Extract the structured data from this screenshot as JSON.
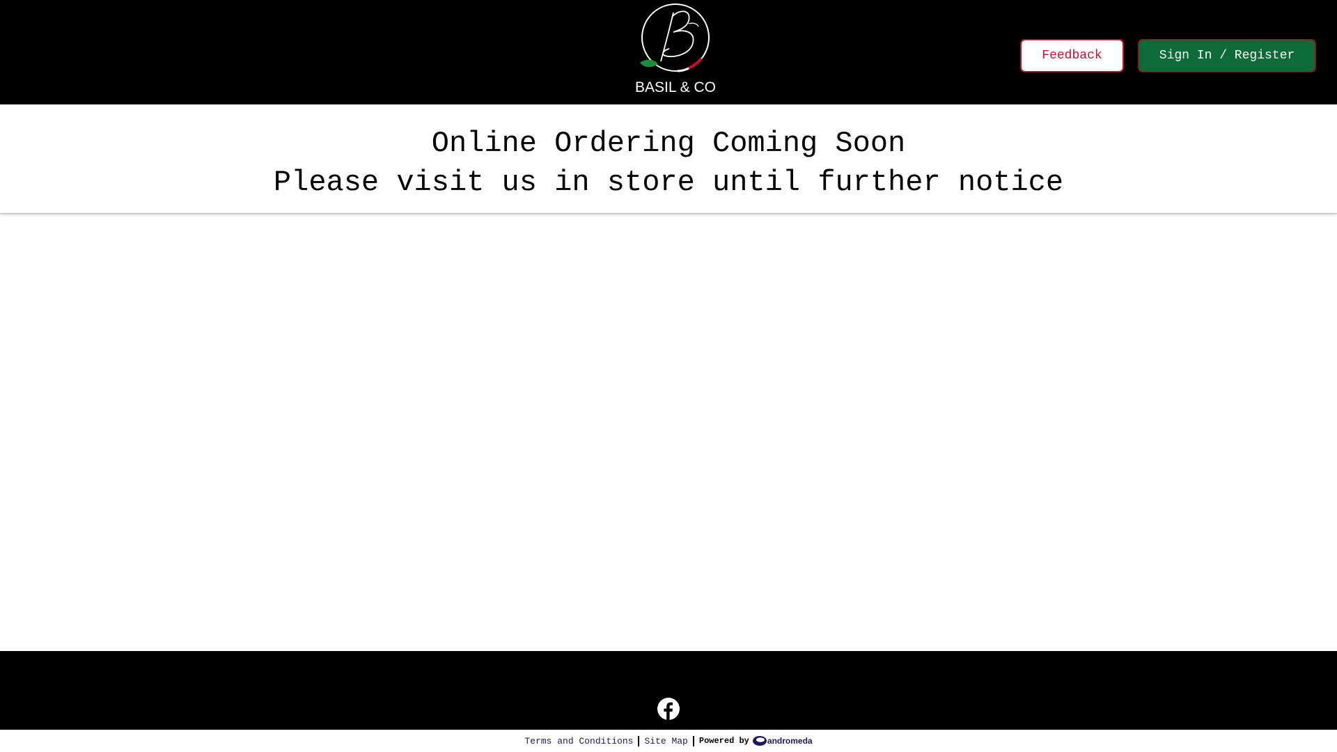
{
  "header": {
    "logo_text": "BASIL & CO",
    "feedback_label": "Feedback",
    "signin_label": "Sign In / Register"
  },
  "notice": {
    "line1": "Online Ordering Coming Soon",
    "line2": "Please visit us in store until further notice"
  },
  "footer": {
    "social_icon": "facebook-icon",
    "terms_label": "Terms and Conditions",
    "sitemap_label": "Site Map",
    "powered_label": "Powered by",
    "powered_brand": "andromeda"
  },
  "colors": {
    "header_bg": "#000000",
    "feedback_text": "#c8102e",
    "signin_bg": "#0c6b37",
    "leaf_green": "#1e8a3c",
    "accent_red": "#c8102e"
  }
}
